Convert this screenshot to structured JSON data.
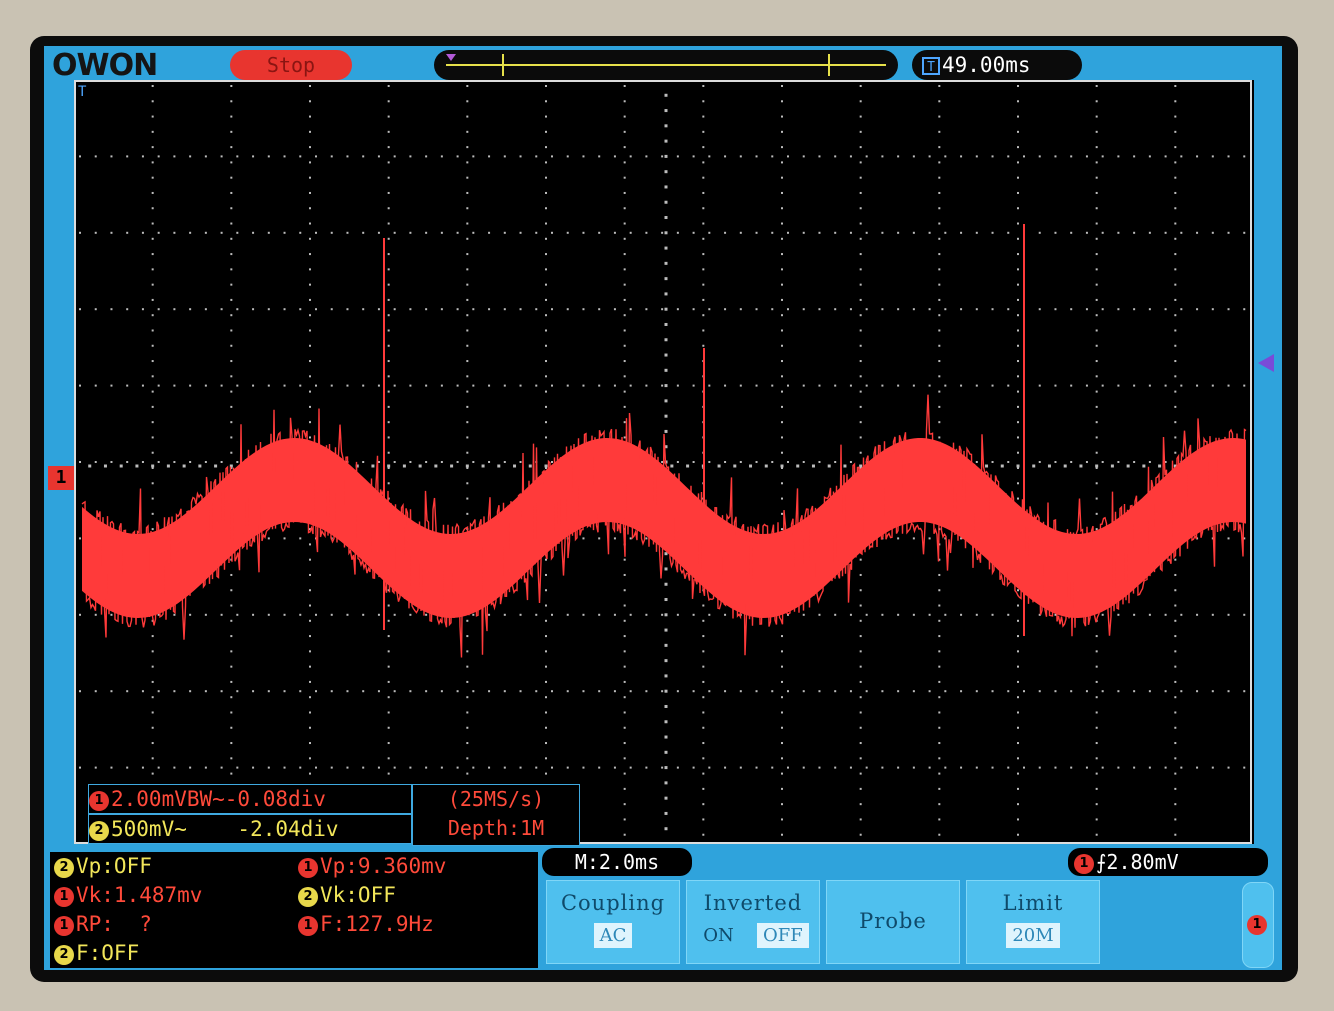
{
  "header": {
    "brand": "OWON",
    "run_status": "Stop",
    "trigger_time": "49.00ms",
    "trigger_icon": "T"
  },
  "channels": {
    "ch1": {
      "badge": "1",
      "scale": "2.00mVBW~-0.08div",
      "color": "#e8352f"
    },
    "ch2": {
      "badge": "2",
      "scale": "500mV~    -2.04div",
      "color": "#e8d84a"
    }
  },
  "acquisition": {
    "sample_rate": "(25MS/s)",
    "depth": "Depth:1M"
  },
  "measurements": {
    "left": [
      {
        "ch": "2",
        "text": "Vp:OFF"
      },
      {
        "ch": "1",
        "text": "Vk:1.487mv"
      },
      {
        "ch": "1",
        "text": "RP:  ?"
      },
      {
        "ch": "2",
        "text": "F:OFF"
      }
    ],
    "right": [
      {
        "ch": "1",
        "text": "Vp:9.360mv"
      },
      {
        "ch": "2",
        "text": "Vk:OFF"
      },
      {
        "ch": "1",
        "text": "F:127.9Hz"
      }
    ]
  },
  "timebase": "M:2.0ms",
  "trigger": {
    "channel": "1",
    "edge_symbol": "⨍",
    "level": "2.80mV"
  },
  "menu": {
    "coupling": {
      "title": "Coupling",
      "value": "AC"
    },
    "inverted": {
      "title": "Inverted",
      "on": "ON",
      "off": "OFF",
      "selected": "OFF"
    },
    "probe": {
      "title": "Probe"
    },
    "limit": {
      "title": "Limit",
      "value": "20M"
    }
  },
  "side_tab": {
    "channel": "1"
  },
  "waveform": {
    "frequency_hz": 127.9,
    "peak_mv": 9.36,
    "color": "#ff3a3a"
  }
}
